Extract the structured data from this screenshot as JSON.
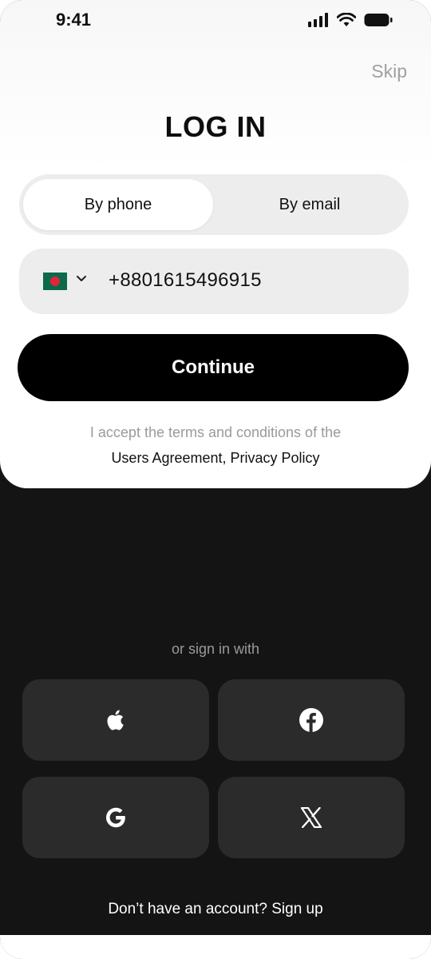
{
  "status_bar": {
    "time": "9:41"
  },
  "header": {
    "skip_label": "Skip",
    "title": "LOG IN"
  },
  "tabs": [
    {
      "label": "By phone",
      "active": true
    },
    {
      "label": "By email",
      "active": false
    }
  ],
  "phone_input": {
    "country_flag": "bangladesh-flag",
    "value": "+8801615496915"
  },
  "continue_label": "Continue",
  "terms": {
    "line1": "I accept the terms and conditions of the",
    "users_agreement": "Users Agreement,",
    "privacy_policy": "Privacy Policy"
  },
  "social": {
    "or_text": "or sign in with",
    "providers": [
      {
        "name": "Apple",
        "icon": "apple-icon"
      },
      {
        "name": "Facebook",
        "icon": "facebook-icon"
      },
      {
        "name": "Google",
        "icon": "google-icon"
      },
      {
        "name": "X",
        "icon": "x-icon"
      }
    ]
  },
  "signup": {
    "prompt": "Don’t have an account?",
    "link": "Sign up"
  },
  "colors": {
    "primary_button": "#000000",
    "dark_background": "#141414",
    "social_button": "#2b2b2b",
    "muted_text": "#9a9a9a"
  }
}
